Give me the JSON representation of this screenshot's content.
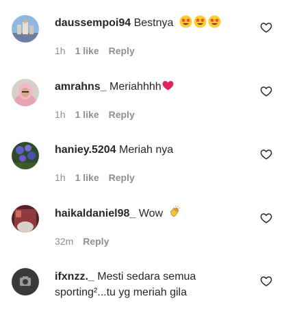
{
  "comments": [
    {
      "username": "daussempoi94",
      "text": "Bestnya",
      "emojis": [
        "star-struck-emoji",
        "star-struck-emoji",
        "star-struck-emoji"
      ],
      "time": "1h",
      "likes": "1 like",
      "reply": "Reply"
    },
    {
      "username": "amrahns_",
      "text": "Meriahhhh",
      "emojis": [
        "red-heart-emoji"
      ],
      "time": "1h",
      "likes": "1 like",
      "reply": "Reply"
    },
    {
      "username": "haniey.5204",
      "text": "Meriah nya",
      "time": "1h",
      "likes": "1 like",
      "reply": "Reply"
    },
    {
      "username": "haikaldaniel98_",
      "text": "Wow",
      "emojis": [
        "clapping-hands-emoji"
      ],
      "time": "32m",
      "reply": "Reply"
    },
    {
      "username": "ifxnzz._",
      "text": "Mesti sedara semua sporting²...tu yg meriah gila"
    }
  ],
  "icons": {
    "like": "heart-outline-icon"
  },
  "colors": {
    "text": "#262626",
    "meta": "#8e8e8e",
    "heart_emoji": "#e0245e"
  }
}
